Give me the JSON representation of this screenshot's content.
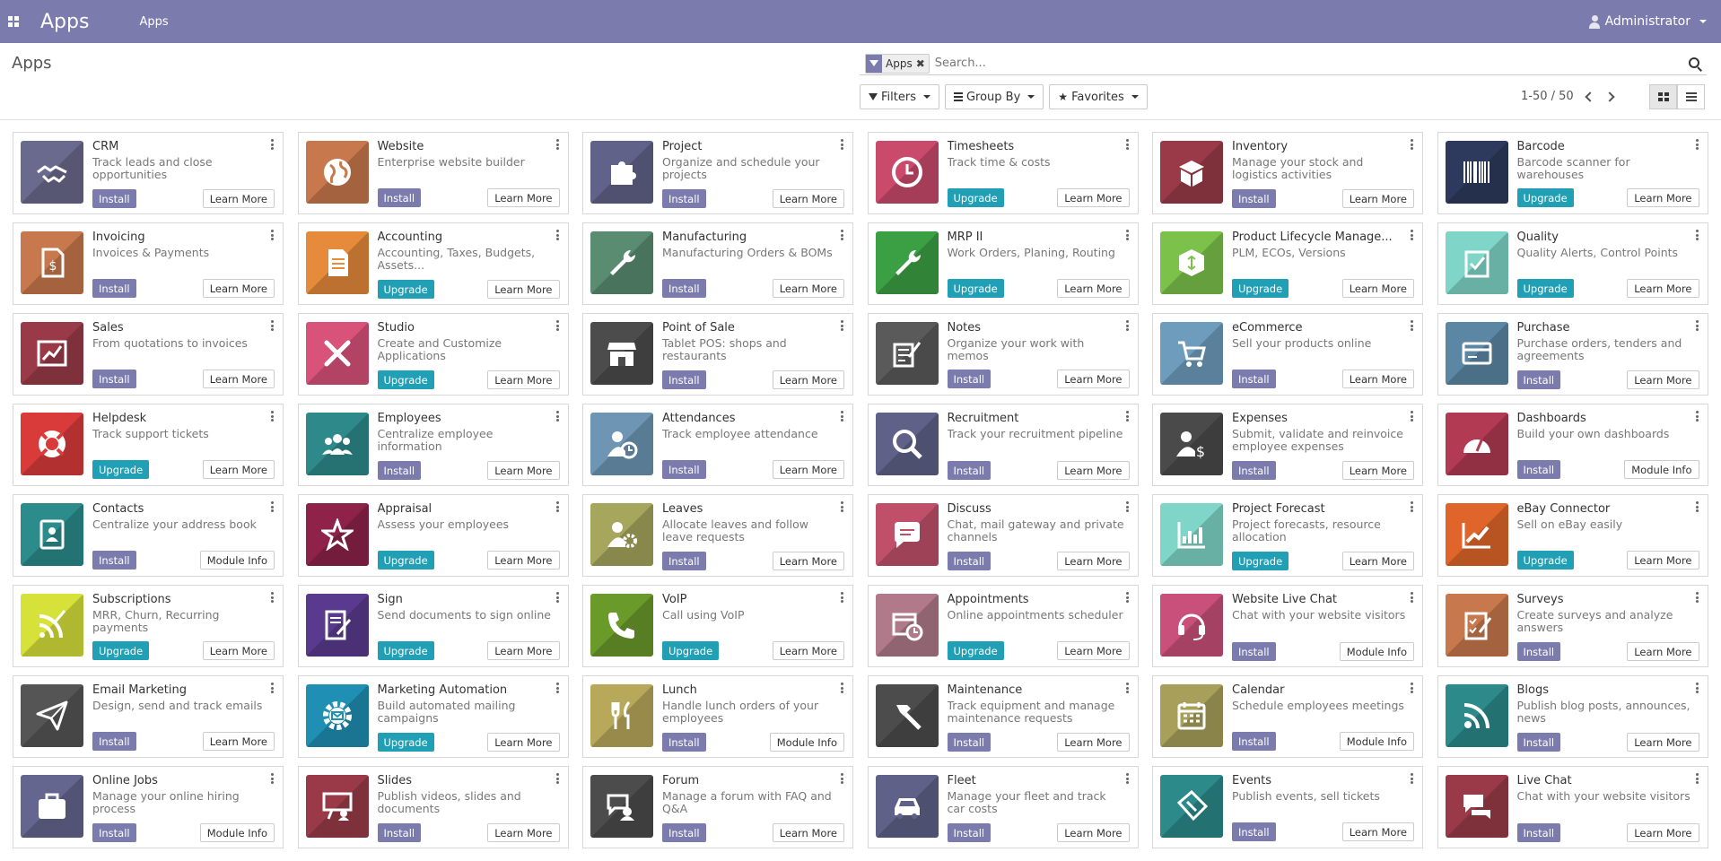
{
  "navbar": {
    "app_title": "Apps",
    "menu_item": "Apps",
    "user": "Administrator"
  },
  "control_panel": {
    "breadcrumb": "Apps",
    "facet": "Apps",
    "search_placeholder": "Search...",
    "filters_label": "Filters",
    "groupby_label": "Group By",
    "favorites_label": "Favorites",
    "pager": "1-50 / 50"
  },
  "apps": [
    {
      "name": "CRM",
      "summary": "Track leads and close opportunities",
      "action": "Install",
      "info": "Learn More",
      "color": "#6a6a8e",
      "icon": "handshake-icon"
    },
    {
      "name": "Website",
      "summary": "Enterprise website builder",
      "action": "Install",
      "info": "Learn More",
      "color": "#c8784d",
      "icon": "globe-icon"
    },
    {
      "name": "Project",
      "summary": "Organize and schedule your projects",
      "action": "Install",
      "info": "Learn More",
      "color": "#61628a",
      "icon": "puzzle-icon"
    },
    {
      "name": "Timesheets",
      "summary": "Track time & costs",
      "action": "Upgrade",
      "info": "Learn More",
      "color": "#c94a6b",
      "icon": "clock-icon"
    },
    {
      "name": "Inventory",
      "summary": "Manage your stock and logistics activities",
      "action": "Install",
      "info": "Learn More",
      "color": "#9a3a48",
      "icon": "box-icon"
    },
    {
      "name": "Barcode",
      "summary": "Barcode scanner for warehouses",
      "action": "Upgrade",
      "info": "Learn More",
      "color": "#2d3a5e",
      "icon": "barcode-icon"
    },
    {
      "name": "Invoicing",
      "summary": "Invoices & Payments",
      "action": "Install",
      "info": "Learn More",
      "color": "#c8784d",
      "icon": "invoice-icon"
    },
    {
      "name": "Accounting",
      "summary": "Accounting, Taxes, Budgets, Assets...",
      "action": "Upgrade",
      "info": "Learn More",
      "color": "#e68a3c",
      "icon": "document-icon"
    },
    {
      "name": "Manufacturing",
      "summary": "Manufacturing Orders & BOMs",
      "action": "Install",
      "info": "Learn More",
      "color": "#5a8c72",
      "icon": "wrench-icon"
    },
    {
      "name": "MRP II",
      "summary": "Work Orders, Planing, Routing",
      "action": "Upgrade",
      "info": "Learn More",
      "color": "#3ba043",
      "icon": "wrench-icon"
    },
    {
      "name": "Product Lifecycle Manage...",
      "summary": "PLM, ECOs, Versions",
      "action": "Upgrade",
      "info": "Learn More",
      "color": "#7cc24a",
      "icon": "cube-icon"
    },
    {
      "name": "Quality",
      "summary": "Quality Alerts, Control Points",
      "action": "Upgrade",
      "info": "Learn More",
      "color": "#7fd6c8",
      "icon": "clipboard-check-icon"
    },
    {
      "name": "Sales",
      "summary": "From quotations to invoices",
      "action": "Install",
      "info": "Learn More",
      "color": "#9a3a48",
      "icon": "chart-up-icon"
    },
    {
      "name": "Studio",
      "summary": "Create and Customize Applications",
      "action": "Upgrade",
      "info": "Learn More",
      "color": "#d9527a",
      "icon": "tools-icon"
    },
    {
      "name": "Point of Sale",
      "summary": "Tablet POS: shops and restaurants",
      "action": "Install",
      "info": "Learn More",
      "color": "#4c4c4c",
      "icon": "shop-icon"
    },
    {
      "name": "Notes",
      "summary": "Organize your work with memos",
      "action": "Install",
      "info": "Learn More",
      "color": "#5a5a5a",
      "icon": "note-icon"
    },
    {
      "name": "eCommerce",
      "summary": "Sell your products online",
      "action": "Install",
      "info": "Learn More",
      "color": "#6e9cbd",
      "icon": "cart-icon"
    },
    {
      "name": "Purchase",
      "summary": "Purchase orders, tenders and agreements",
      "action": "Install",
      "info": "Learn More",
      "color": "#5b87a4",
      "icon": "card-icon"
    },
    {
      "name": "Helpdesk",
      "summary": "Track support tickets",
      "action": "Upgrade",
      "info": "Learn More",
      "color": "#d93a3a",
      "icon": "lifebuoy-icon"
    },
    {
      "name": "Employees",
      "summary": "Centralize employee information",
      "action": "Install",
      "info": "Learn More",
      "color": "#2e8a8a",
      "icon": "people-icon"
    },
    {
      "name": "Attendances",
      "summary": "Track employee attendance",
      "action": "Install",
      "info": "Learn More",
      "color": "#6e96b4",
      "icon": "user-clock-icon"
    },
    {
      "name": "Recruitment",
      "summary": "Track your recruitment pipeline",
      "action": "Install",
      "info": "Learn More",
      "color": "#5f6188",
      "icon": "magnifier-icon"
    },
    {
      "name": "Expenses",
      "summary": "Submit, validate and reinvoice employee expenses",
      "action": "Install",
      "info": "Learn More",
      "color": "#4a4a4a",
      "icon": "user-dollar-icon"
    },
    {
      "name": "Dashboards",
      "summary": "Build your own dashboards",
      "action": "Install",
      "info": "Module Info",
      "color": "#b23a52",
      "icon": "gauge-icon"
    },
    {
      "name": "Contacts",
      "summary": "Centralize your address book",
      "action": "Install",
      "info": "Module Info",
      "color": "#2c8c8c",
      "icon": "contact-book-icon"
    },
    {
      "name": "Appraisal",
      "summary": "Assess your employees",
      "action": "Upgrade",
      "info": "Learn More",
      "color": "#8e2248",
      "icon": "star-icon"
    },
    {
      "name": "Leaves",
      "summary": "Allocate leaves and follow leave requests",
      "action": "Install",
      "info": "Learn More",
      "color": "#a6a65c",
      "icon": "user-gear-icon"
    },
    {
      "name": "Discuss",
      "summary": "Chat, mail gateway and private channels",
      "action": "Install",
      "info": "Learn More",
      "color": "#c0506a",
      "icon": "chat-icon"
    },
    {
      "name": "Project Forecast",
      "summary": "Project forecasts, resource allocation",
      "action": "Upgrade",
      "info": "Learn More",
      "color": "#7fd6c8",
      "icon": "bar-chart-icon"
    },
    {
      "name": "eBay Connector",
      "summary": "Sell on eBay easily",
      "action": "Upgrade",
      "info": "Learn More",
      "color": "#e0652a",
      "icon": "trend-icon"
    },
    {
      "name": "Subscriptions",
      "summary": "MRR, Churn, Recurring payments",
      "action": "Upgrade",
      "info": "Learn More",
      "color": "#d6e23a",
      "icon": "rss-pen-icon"
    },
    {
      "name": "Sign",
      "summary": "Send documents to sign online",
      "action": "Upgrade",
      "info": "Learn More",
      "color": "#5a3a8e",
      "icon": "sign-icon"
    },
    {
      "name": "VoIP",
      "summary": "Call using VoIP",
      "action": "Upgrade",
      "info": "Learn More",
      "color": "#6a9a2a",
      "icon": "phone-icon"
    },
    {
      "name": "Appointments",
      "summary": "Online appointments scheduler",
      "action": "Upgrade",
      "info": "Learn More",
      "color": "#b07a8a",
      "icon": "calendar-clock-icon"
    },
    {
      "name": "Website Live Chat",
      "summary": "Chat with your website visitors",
      "action": "Install",
      "info": "Module Info",
      "color": "#c9507a",
      "icon": "headset-icon"
    },
    {
      "name": "Surveys",
      "summary": "Create surveys and analyze answers",
      "action": "Install",
      "info": "Learn More",
      "color": "#c8784d",
      "icon": "survey-icon"
    },
    {
      "name": "Email Marketing",
      "summary": "Design, send and track emails",
      "action": "Install",
      "info": "Learn More",
      "color": "#555555",
      "icon": "paper-plane-icon"
    },
    {
      "name": "Marketing Automation",
      "summary": "Build automated mailing campaigns",
      "action": "Upgrade",
      "info": "Learn More",
      "color": "#1f8fb3",
      "icon": "gear-mail-icon"
    },
    {
      "name": "Lunch",
      "summary": "Handle lunch orders of your employees",
      "action": "Install",
      "info": "Module Info",
      "color": "#b8a85a",
      "icon": "cutlery-icon"
    },
    {
      "name": "Maintenance",
      "summary": "Track equipment and manage maintenance requests",
      "action": "Install",
      "info": "Learn More",
      "color": "#4c4c4c",
      "icon": "hammer-icon"
    },
    {
      "name": "Calendar",
      "summary": "Schedule employees meetings",
      "action": "Install",
      "info": "Module Info",
      "color": "#a8a05a",
      "icon": "calendar-icon"
    },
    {
      "name": "Blogs",
      "summary": "Publish blog posts, announces, news",
      "action": "Install",
      "info": "Learn More",
      "color": "#2c8a8a",
      "icon": "rss-icon"
    },
    {
      "name": "Online Jobs",
      "summary": "Manage your online hiring process",
      "action": "Install",
      "info": "Module Info",
      "color": "#65668f",
      "icon": "briefcase-icon"
    },
    {
      "name": "Slides",
      "summary": "Publish videos, slides and documents",
      "action": "Install",
      "info": "Learn More",
      "color": "#9a3a48",
      "icon": "presentation-icon"
    },
    {
      "name": "Forum",
      "summary": "Manage a forum with FAQ and Q&A",
      "action": "Install",
      "info": "Learn More",
      "color": "#4c4c4c",
      "icon": "forum-icon"
    },
    {
      "name": "Fleet",
      "summary": "Manage your fleet and track car costs",
      "action": "Install",
      "info": "Learn More",
      "color": "#5f6188",
      "icon": "car-icon"
    },
    {
      "name": "Events",
      "summary": "Publish events, sell tickets",
      "action": "Install",
      "info": "Learn More",
      "color": "#2c8a8a",
      "icon": "ticket-icon"
    },
    {
      "name": "Live Chat",
      "summary": "Chat with your website visitors",
      "action": "Install",
      "info": "Learn More",
      "color": "#9a3a48",
      "icon": "chat-bubbles-icon"
    }
  ]
}
